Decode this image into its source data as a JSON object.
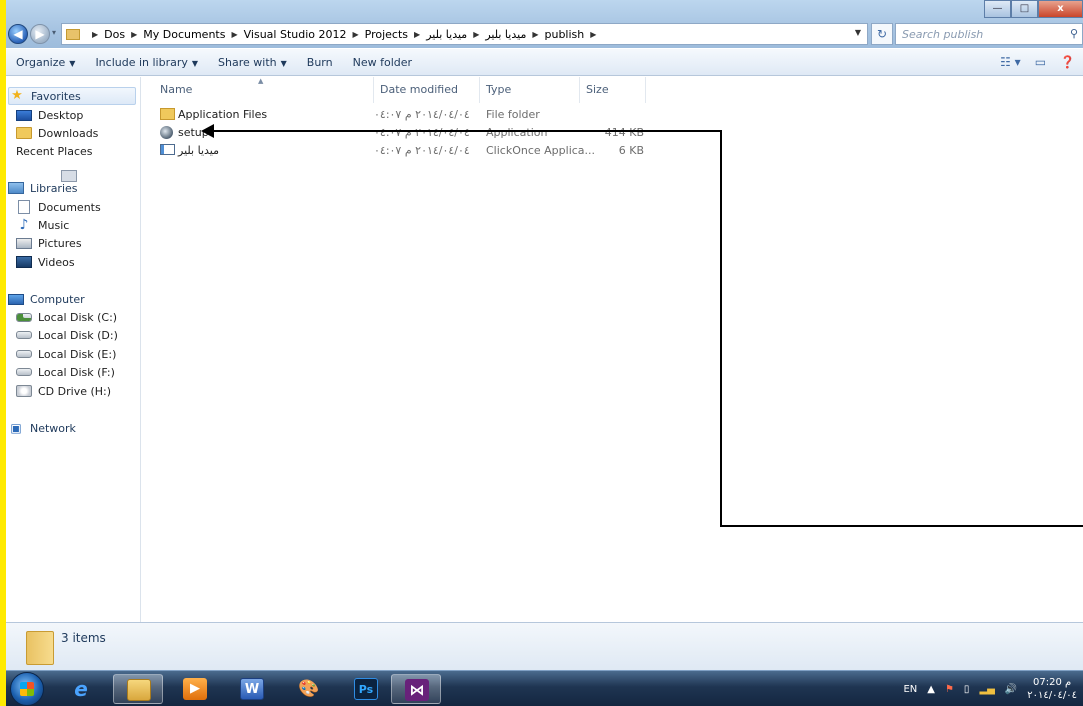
{
  "window": {
    "minimize": "—",
    "maximize": "□",
    "close": "x"
  },
  "address": {
    "recent_label": "▾",
    "crumbs": [
      "Dos",
      "My Documents",
      "Visual Studio 2012",
      "Projects",
      "ميديا بلير",
      "ميديا بلير",
      "publish"
    ],
    "search_placeholder": "Search publish"
  },
  "commands": {
    "organize": "Organize",
    "include": "Include in library",
    "share": "Share with",
    "burn": "Burn",
    "new_folder": "New folder"
  },
  "nav": {
    "favorites": "Favorites",
    "desktop": "Desktop",
    "downloads": "Downloads",
    "recent": "Recent Places",
    "libraries": "Libraries",
    "documents": "Documents",
    "music": "Music",
    "pictures": "Pictures",
    "videos": "Videos",
    "computer": "Computer",
    "disk_c": "Local Disk (C:)",
    "disk_d": "Local Disk (D:)",
    "disk_e": "Local Disk (E:)",
    "disk_f": "Local Disk (F:)",
    "cd": "CD Drive (H:)",
    "network": "Network"
  },
  "columns": {
    "name": "Name",
    "date": "Date modified",
    "type": "Type",
    "size": "Size"
  },
  "files": [
    {
      "name": "Application Files",
      "date": "٢٠١٤/٠٤/٠٤ م ٠٤:٠٧",
      "type": "File folder",
      "size": ""
    },
    {
      "name": "setup",
      "date": "٢٠١٤/٠٤/٠٤ م ٠٤:٠٧",
      "type": "Application",
      "size": "414 KB"
    },
    {
      "name": "ميديا بلير",
      "date": "٢٠١٤/٠٤/٠٤ م ٠٤:٠٧",
      "type": "ClickOnce Applica...",
      "size": "6 KB"
    }
  ],
  "details": {
    "count": "3 items"
  },
  "taskbar": {
    "lang": "EN",
    "time": "07:20 م",
    "date": "٢٠١٤/٠٤/٠٤"
  }
}
